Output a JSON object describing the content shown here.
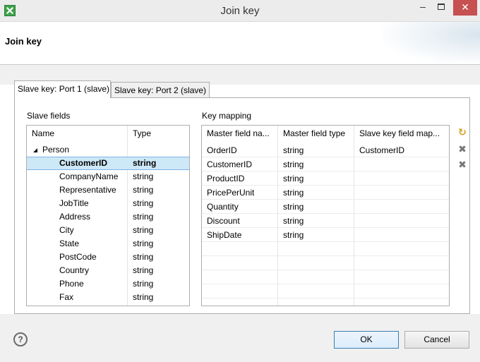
{
  "window": {
    "title": "Join key",
    "minimize": "–",
    "close": "✕"
  },
  "header": {
    "title": "Join key"
  },
  "tabs": [
    {
      "label": "Slave key: Port 1 (slave)",
      "active": true
    },
    {
      "label": "Slave key: Port 2 (slave)",
      "active": false
    }
  ],
  "slave_fields": {
    "label": "Slave fields",
    "columns": [
      "Name",
      "Type"
    ],
    "group": "Person",
    "group_arrow": "◢",
    "rows": [
      {
        "name": "CustomerID",
        "type": "string",
        "selected": true
      },
      {
        "name": "CompanyName",
        "type": "string"
      },
      {
        "name": "Representative",
        "type": "string"
      },
      {
        "name": "JobTitle",
        "type": "string"
      },
      {
        "name": "Address",
        "type": "string"
      },
      {
        "name": "City",
        "type": "string"
      },
      {
        "name": "State",
        "type": "string"
      },
      {
        "name": "PostCode",
        "type": "string"
      },
      {
        "name": "Country",
        "type": "string"
      },
      {
        "name": "Phone",
        "type": "string"
      },
      {
        "name": "Fax",
        "type": "string"
      }
    ]
  },
  "key_mapping": {
    "label": "Key mapping",
    "columns": [
      "Master field na...",
      "Master field type",
      "Slave key field map..."
    ],
    "rows": [
      {
        "master": "OrderID",
        "type": "string",
        "slave": "CustomerID"
      },
      {
        "master": "CustomerID",
        "type": "string",
        "slave": ""
      },
      {
        "master": "ProductID",
        "type": "string",
        "slave": ""
      },
      {
        "master": "PricePerUnit",
        "type": "string",
        "slave": ""
      },
      {
        "master": "Quantity",
        "type": "string",
        "slave": ""
      },
      {
        "master": "Discount",
        "type": "string",
        "slave": ""
      },
      {
        "master": "ShipDate",
        "type": "string",
        "slave": ""
      }
    ]
  },
  "tools": [
    {
      "name": "auto-map-icon",
      "glyph": "↻"
    },
    {
      "name": "delete-icon",
      "glyph": "✖"
    },
    {
      "name": "delete-all-icon",
      "glyph": "✖"
    }
  ],
  "buttons": {
    "help": "?",
    "ok": "OK",
    "cancel": "Cancel"
  }
}
